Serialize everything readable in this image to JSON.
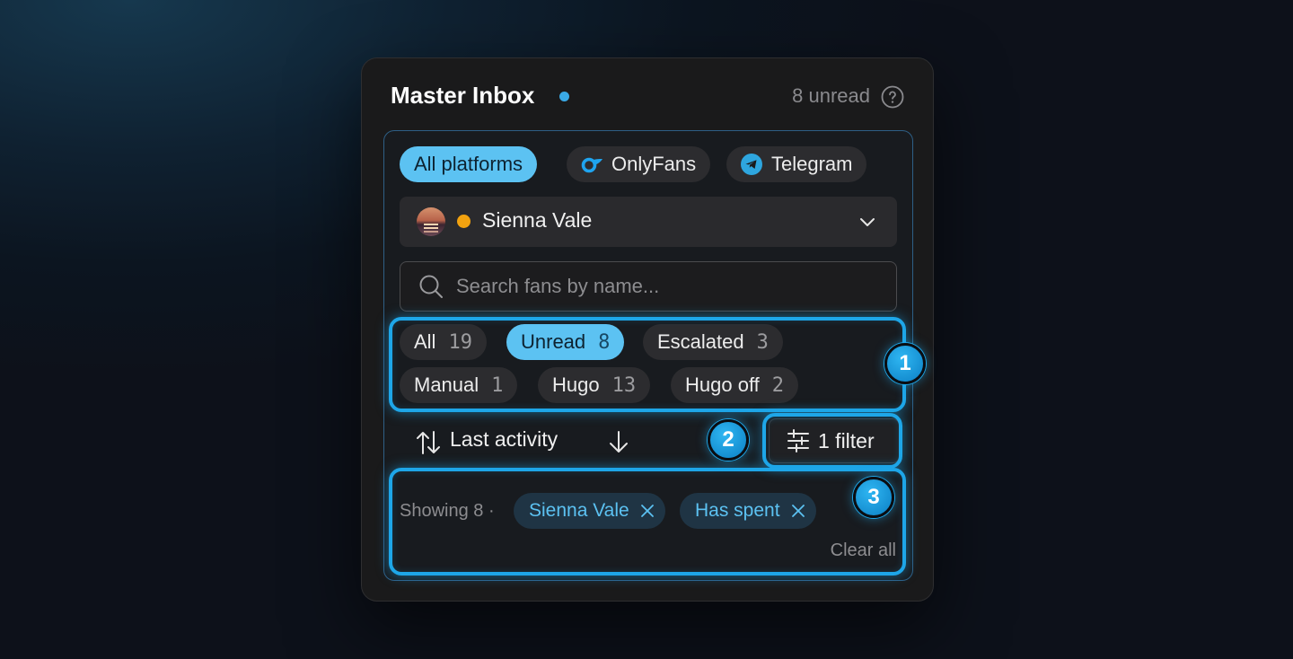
{
  "header": {
    "title": "Master Inbox",
    "unread": "8 unread",
    "help_icon": "help-circle-icon",
    "accent": "#3aa9e6"
  },
  "platforms": [
    {
      "label": "All platforms",
      "icon": null,
      "active": true
    },
    {
      "label": "OnlyFans",
      "icon": "onlyfans-icon",
      "active": false
    },
    {
      "label": "Telegram",
      "icon": "telegram-icon",
      "active": false
    }
  ],
  "account": {
    "name": "Sienna Vale",
    "status_color": "#f2a20f",
    "icon": "chevron-down-icon"
  },
  "search": {
    "placeholder": "Search fans by name...",
    "value": ""
  },
  "status_filters": [
    {
      "label": "All",
      "count": "19",
      "active": false
    },
    {
      "label": "Unread",
      "count": "8",
      "active": true
    },
    {
      "label": "Escalated",
      "count": "3",
      "active": false
    },
    {
      "label": "Manual",
      "count": "1",
      "active": false
    },
    {
      "label": "Hugo",
      "count": "13",
      "active": false
    },
    {
      "label": "Hugo off",
      "count": "2",
      "active": false
    }
  ],
  "sort": {
    "label": "Last activity",
    "direction": "descending",
    "icon": "sort-icon"
  },
  "filter_button": {
    "label": "1 filter",
    "icon": "sliders-icon"
  },
  "active_filters": {
    "showing": "Showing 8 ·",
    "chips": [
      "Sienna Vale",
      "Has spent"
    ],
    "clear_label": "Clear all"
  },
  "callouts": [
    "1",
    "2",
    "3"
  ]
}
